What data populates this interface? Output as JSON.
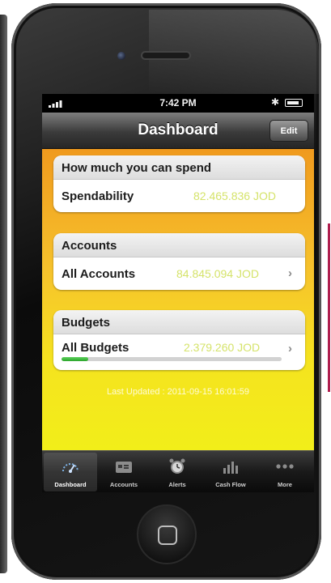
{
  "status_bar": {
    "time": "7:42 PM",
    "bluetooth_glyph": "✱"
  },
  "nav": {
    "title": "Dashboard",
    "edit_label": "Edit"
  },
  "spend_card": {
    "header": "How much you can spend",
    "label": "Spendability",
    "value": "82.465.836 JOD"
  },
  "accounts_card": {
    "header": "Accounts",
    "label": "All Accounts",
    "value": "84.845.094 JOD"
  },
  "budgets_card": {
    "header": "Budgets",
    "label": "All Budgets",
    "value": "2.379.260 JOD",
    "progress_fraction": 0.12
  },
  "chevron": "›",
  "last_updated": "Last Updated : 2011-09-15 16:01:59",
  "colors": {
    "value_text": "#d5e36a",
    "progress": "#2aa52a",
    "accent_bar": "#b01e4e"
  },
  "tabs": [
    {
      "label": "Dashboard",
      "icon": "gauge-icon",
      "active": true
    },
    {
      "label": "Accounts",
      "icon": "wallet-icon",
      "active": false
    },
    {
      "label": "Alerts",
      "icon": "alarm-clock-icon",
      "active": false
    },
    {
      "label": "Cash Flow",
      "icon": "bar-chart-icon",
      "active": false
    },
    {
      "label": "More",
      "icon": "more-dots-icon",
      "active": false
    }
  ]
}
